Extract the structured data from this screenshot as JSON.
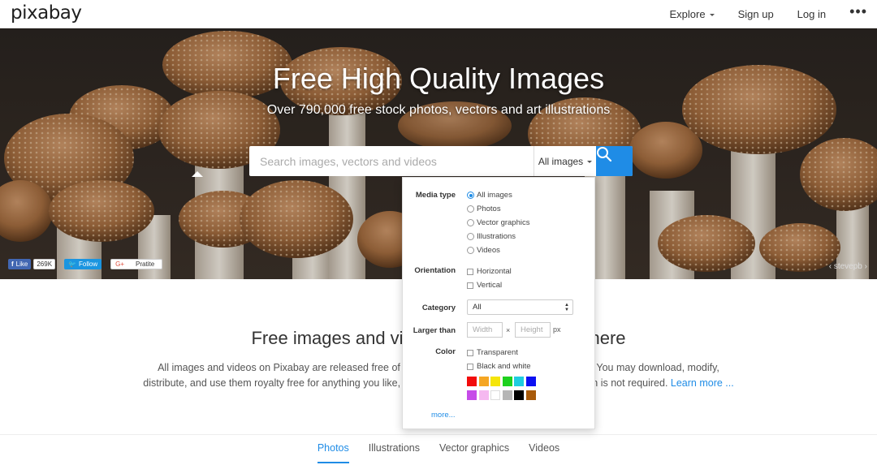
{
  "brand": {
    "logo": "pixabay"
  },
  "nav": {
    "explore": "Explore",
    "signup": "Sign up",
    "login": "Log in",
    "more": "•••"
  },
  "hero": {
    "title": "Free High Quality Images",
    "subtitle": "Over 790,000 free stock photos, vectors and art illustrations",
    "search_placeholder": "Search images, vectors and videos",
    "search_type": "All images",
    "credit": "stevepb"
  },
  "social": {
    "fb_like": "Like",
    "fb_count": "269K",
    "tw_follow": "Follow",
    "gplus": "Pratite"
  },
  "filters": {
    "media_type_label": "Media type",
    "media_types": [
      "All images",
      "Photos",
      "Vector graphics",
      "Illustrations",
      "Videos"
    ],
    "selected_media_type": 0,
    "orientation_label": "Orientation",
    "orientations": [
      "Horizontal",
      "Vertical"
    ],
    "category_label": "Category",
    "category_value": "All",
    "larger_than_label": "Larger than",
    "width_placeholder": "Width",
    "height_placeholder": "Height",
    "times": "×",
    "unit": "px",
    "color_label": "Color",
    "color_options": [
      "Transparent",
      "Black and white"
    ],
    "swatches": [
      "#f20c0c",
      "#f5a623",
      "#f5e50a",
      "#1ed11e",
      "#1ecde0",
      "#0c10f2",
      "#c64be8",
      "#f5b8f0",
      "#ffffff",
      "#b5b5b5",
      "#000000",
      "#a85a0a"
    ],
    "more": "more..."
  },
  "section": {
    "title": "Free images and videos you can use anywhere",
    "desc_part1": "All images and videos on Pixabay are released free of copyrights under Creative Commons CC0. You may download, modify, distribute, and use them royalty free for anything you like, even in commercial applications. Attribution is not required.",
    "learn_more": "Learn more ..."
  },
  "tabs": [
    "Photos",
    "Illustrations",
    "Vector graphics",
    "Videos"
  ],
  "colors": {
    "accent": "#1f8ce6"
  }
}
